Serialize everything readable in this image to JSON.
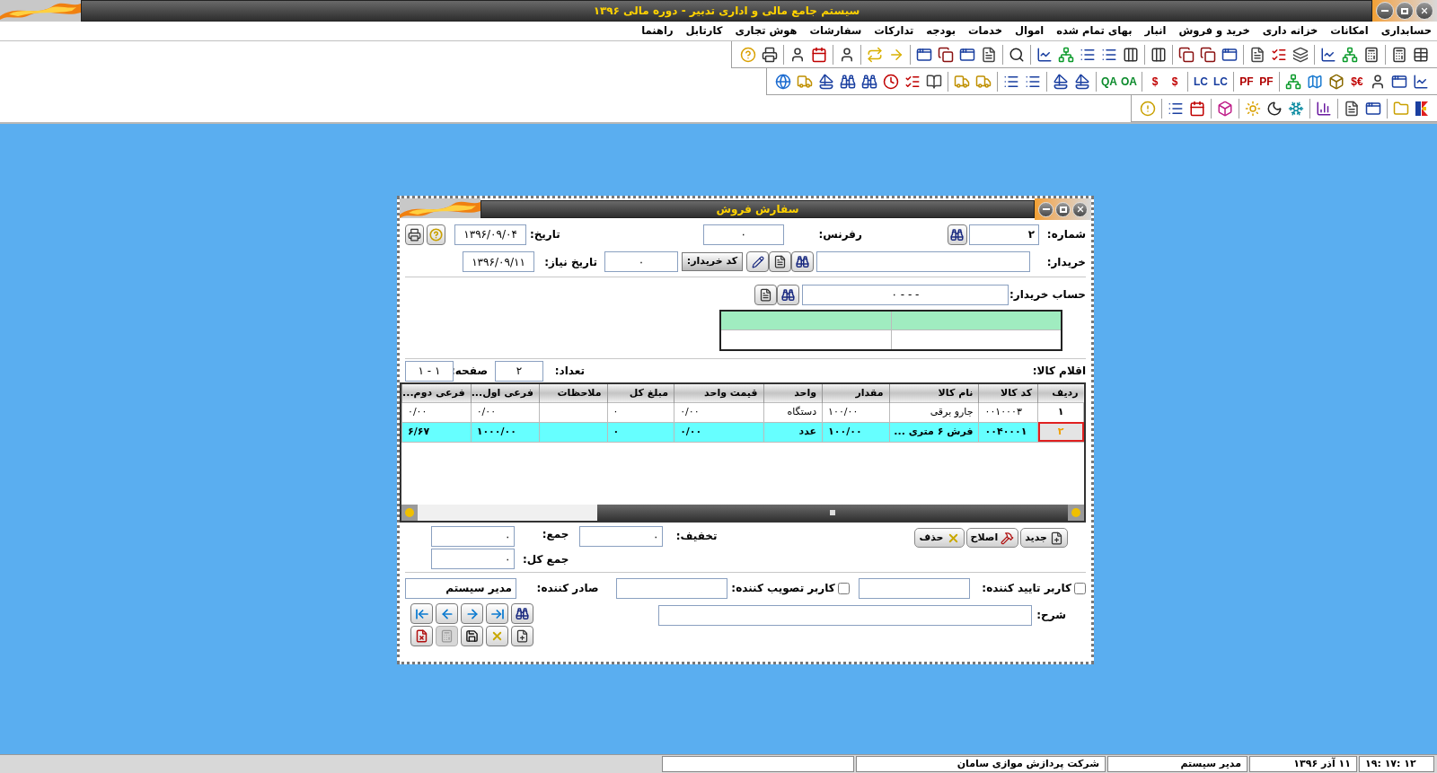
{
  "window": {
    "title": "سیستم جامع مالی و اداری تدبیر - دوره مالی ۱۳۹۶"
  },
  "menu": [
    "حسابداری",
    "امکانات",
    "خزانه داری",
    "خرید و فروش",
    "انبار",
    "بهای تمام شده",
    "اموال",
    "خدمات",
    "بودجه",
    "تدارکات",
    "سفارشات",
    "هوش تجاری",
    "کارتابل",
    "راهنما"
  ],
  "toolbars": [
    [
      {
        "kind": "grid"
      },
      {
        "kind": "calc"
      },
      {
        "kind": "sep"
      },
      {
        "kind": "calc"
      },
      {
        "kind": "tree"
      },
      {
        "kind": "chart"
      },
      {
        "kind": "sep"
      },
      {
        "kind": "stack"
      },
      {
        "kind": "check"
      },
      {
        "kind": "doc"
      },
      {
        "kind": "sep"
      },
      {
        "kind": "window"
      },
      {
        "kind": "copy"
      },
      {
        "kind": "copy"
      },
      {
        "kind": "sep"
      },
      {
        "kind": "pillar"
      },
      {
        "kind": "sep"
      },
      {
        "kind": "pillar"
      },
      {
        "kind": "list"
      },
      {
        "kind": "list"
      },
      {
        "kind": "tree"
      },
      {
        "kind": "chart"
      },
      {
        "kind": "sep"
      },
      {
        "kind": "search"
      },
      {
        "kind": "sep"
      },
      {
        "kind": "doc"
      },
      {
        "kind": "window"
      },
      {
        "kind": "copy"
      },
      {
        "kind": "window"
      },
      {
        "kind": "sep"
      },
      {
        "kind": "arrow"
      },
      {
        "kind": "repeat"
      },
      {
        "kind": "sep"
      },
      {
        "kind": "person"
      },
      {
        "kind": "sep"
      },
      {
        "kind": "calendar"
      },
      {
        "kind": "person"
      },
      {
        "kind": "sep"
      },
      {
        "kind": "print"
      },
      {
        "kind": "help"
      }
    ],
    [
      {
        "kind": "chart"
      },
      {
        "kind": "window"
      },
      {
        "kind": "person"
      },
      {
        "kind": "glyph",
        "text": "$€",
        "color": "#c00000"
      },
      {
        "kind": "box"
      },
      {
        "kind": "map"
      },
      {
        "kind": "tree"
      },
      {
        "kind": "sep"
      },
      {
        "kind": "glyph",
        "text": "PF",
        "color": "#b00000"
      },
      {
        "kind": "glyph",
        "text": "PF",
        "color": "#b00000"
      },
      {
        "kind": "sep"
      },
      {
        "kind": "glyph",
        "text": "LC",
        "color": "#1a3fa0"
      },
      {
        "kind": "glyph",
        "text": "LC",
        "color": "#1a3fa0"
      },
      {
        "kind": "sep"
      },
      {
        "kind": "glyph",
        "text": "$",
        "color": "#c00000"
      },
      {
        "kind": "glyph",
        "text": "$",
        "color": "#c00000"
      },
      {
        "kind": "sep"
      },
      {
        "kind": "glyph",
        "text": "OA",
        "color": "#0a8a2a"
      },
      {
        "kind": "glyph",
        "text": "QA",
        "color": "#0a8a2a"
      },
      {
        "kind": "sep"
      },
      {
        "kind": "sail"
      },
      {
        "kind": "sail"
      },
      {
        "kind": "sep"
      },
      {
        "kind": "list"
      },
      {
        "kind": "list"
      },
      {
        "kind": "sep"
      },
      {
        "kind": "truck"
      },
      {
        "kind": "truck"
      },
      {
        "kind": "sep"
      },
      {
        "kind": "book"
      },
      {
        "kind": "check"
      },
      {
        "kind": "clock"
      },
      {
        "kind": "binoculars"
      },
      {
        "kind": "binoculars"
      },
      {
        "kind": "sail"
      },
      {
        "kind": "truck"
      },
      {
        "kind": "globe"
      }
    ],
    [
      {
        "kind": "logo"
      },
      {
        "kind": "folder"
      },
      {
        "kind": "sep"
      },
      {
        "kind": "window"
      },
      {
        "kind": "doc"
      },
      {
        "kind": "sep"
      },
      {
        "kind": "bars"
      },
      {
        "kind": "sep"
      },
      {
        "kind": "snow"
      },
      {
        "kind": "moon"
      },
      {
        "kind": "sun"
      },
      {
        "kind": "sep"
      },
      {
        "kind": "cube"
      },
      {
        "kind": "sep"
      },
      {
        "kind": "calendar"
      },
      {
        "kind": "list"
      },
      {
        "kind": "sep"
      },
      {
        "kind": "warning"
      }
    ]
  ],
  "dialog": {
    "title": "سفارش فروش",
    "number": {
      "label": "شماره:",
      "value": "۲"
    },
    "reference": {
      "label": "رفرنس:",
      "value": "۰"
    },
    "date": {
      "label": "تاریخ:",
      "value": "۱۳۹۶/۰۹/۰۴"
    },
    "buyer": {
      "label": "خریدار:"
    },
    "buyer_code_button": "کد خریدار:",
    "buyer_code": {
      "value": "۰"
    },
    "need_date": {
      "label": "تاریخ نیاز:",
      "value": "۱۳۹۶/۰۹/۱۱"
    },
    "buyer_account": {
      "label": "حساب خریدار:",
      "value": "- - - ۰"
    },
    "items_label": "اقلام کالا:",
    "count": {
      "label": "تعداد:",
      "value": "۲"
    },
    "page": {
      "label": "صفحه:",
      "value": "۱ - ۱"
    },
    "table": {
      "columns": [
        "ردیف",
        "کد کالا",
        "نام کالا",
        "مقدار",
        "واحد",
        "قیمت واحد",
        "مبلغ کل",
        "ملاحظات",
        "فرعی اول...",
        "فرعی دوم..."
      ],
      "rows": [
        {
          "selected": false,
          "cells": [
            "۱",
            "۰۰۱۰۰۰۳",
            "جارو برقی",
            "۱۰۰/۰۰",
            "دستگاه",
            "۰/۰۰",
            "۰",
            "",
            "۰/۰۰",
            "۰/۰۰"
          ]
        },
        {
          "selected": true,
          "cells": [
            "۲",
            "۰۰۴۰۰۰۱",
            "فرش ۶ متری ...",
            "۱۰۰/۰۰",
            "عدد",
            "۰/۰۰",
            "۰",
            "",
            "۱۰۰۰/۰۰",
            "۶/۶۷"
          ]
        }
      ]
    },
    "row_buttons": [
      {
        "kind": "new",
        "label": "جدید"
      },
      {
        "kind": "edit",
        "label": "اصلاح"
      },
      {
        "kind": "delete",
        "label": "حذف"
      }
    ],
    "discount": {
      "label": "تخفیف:",
      "value": "۰"
    },
    "sum": {
      "label": "جمع:",
      "value": "۰"
    },
    "total": {
      "label": "جمع کل:",
      "value": "۰"
    },
    "confirmer": {
      "label": "کاربر تایید کننده:",
      "checked": false
    },
    "approver": {
      "label": "کاربر تصویب کننده:",
      "checked": false
    },
    "issuer": {
      "label": "صادر کننده:",
      "value": "مدیر سیستم"
    },
    "description": {
      "label": "شرح:"
    },
    "nav_buttons": [
      {
        "kind": "first"
      },
      {
        "kind": "prev"
      },
      {
        "kind": "next"
      },
      {
        "kind": "last"
      },
      {
        "kind": "find"
      }
    ],
    "action_buttons": [
      {
        "kind": "cancel",
        "disabled": false
      },
      {
        "kind": "post",
        "disabled": true
      },
      {
        "kind": "save",
        "disabled": false
      },
      {
        "kind": "delete",
        "disabled": false
      },
      {
        "kind": "new",
        "disabled": false
      }
    ]
  },
  "status_bar": [
    "۱۹: ۱۷: ۱۲",
    "۱۱ آذر ۱۳۹۶",
    "مدیر سیستم",
    "شرکت پردازش موازی سامان"
  ]
}
